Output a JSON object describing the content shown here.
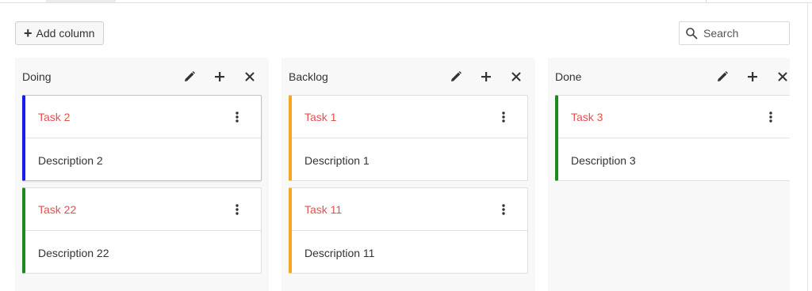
{
  "toolbar": {
    "add_column_label": "Add column"
  },
  "search": {
    "placeholder": "Search",
    "value": ""
  },
  "colors": {
    "card_title": "#e0524f",
    "blue": "#1a1aee",
    "green": "#1d8a1d",
    "orange": "#f5a623"
  },
  "columns": [
    {
      "title": "Doing",
      "cards": [
        {
          "title": "Task 2",
          "description": "Description 2",
          "accent": "blue"
        },
        {
          "title": "Task 22",
          "description": "Description 22",
          "accent": "green"
        }
      ]
    },
    {
      "title": "Backlog",
      "cards": [
        {
          "title": "Task 1",
          "description": "Description 1",
          "accent": "orange"
        },
        {
          "title": "Task 11",
          "description": "Description 11",
          "accent": "orange"
        }
      ]
    },
    {
      "title": "Done",
      "cards": [
        {
          "title": "Task 3",
          "description": "Description 3",
          "accent": "green"
        }
      ]
    }
  ]
}
